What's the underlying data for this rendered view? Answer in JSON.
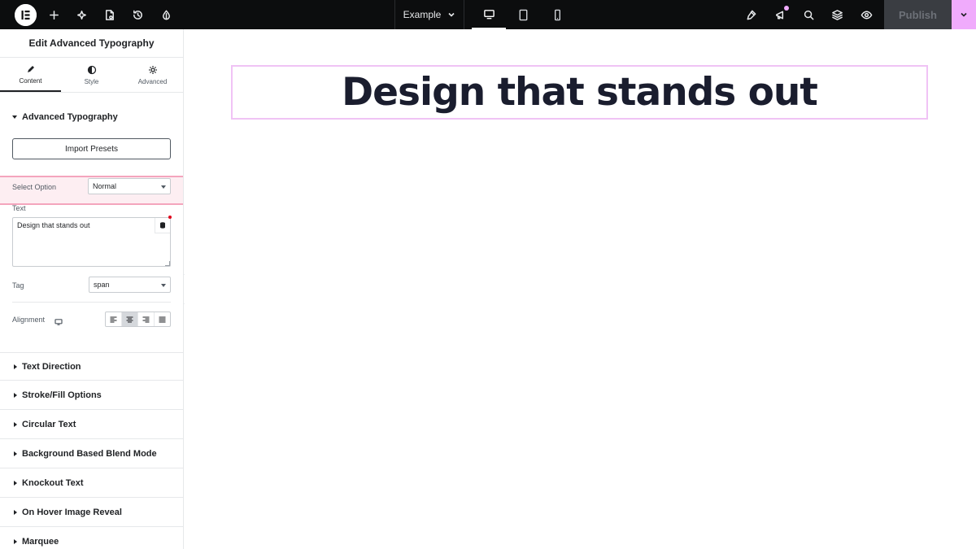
{
  "topbar": {
    "page_name": "Example",
    "publish_label": "Publish",
    "icons": [
      "elementor-logo-icon",
      "add-icon",
      "ai-sparkle-icon",
      "page-settings-icon",
      "history-icon",
      "site-settings-icon",
      "finder-icon",
      "notifications-icon",
      "search-icon",
      "structure-icon",
      "preview-icon"
    ],
    "devices": [
      "desktop",
      "tablet",
      "mobile"
    ],
    "active_device": "desktop",
    "accent_color": "#f0abfc"
  },
  "panel": {
    "title": "Edit Advanced Typography",
    "tabs": [
      {
        "label": "Content",
        "icon": "pencil-icon",
        "active": true
      },
      {
        "label": "Style",
        "icon": "half-circle-icon",
        "active": false
      },
      {
        "label": "Advanced",
        "icon": "gear-icon",
        "active": false
      }
    ],
    "section_title": "Advanced Typography",
    "import_presets_label": "Import Presets",
    "select_option": {
      "label": "Select Option",
      "value": "Normal"
    },
    "text": {
      "label": "Text",
      "value": "Design that stands out"
    },
    "tag": {
      "label": "Tag",
      "value": "span"
    },
    "alignment": {
      "label": "Alignment",
      "options": [
        "left",
        "center",
        "right",
        "justify"
      ],
      "selected": "center"
    },
    "accordions": [
      "Text Direction",
      "Stroke/Fill Options",
      "Circular Text",
      "Background Based Blend Mode",
      "Knockout Text",
      "On Hover Image Reveal",
      "Marquee"
    ]
  },
  "canvas": {
    "heading": "Design that stands out",
    "selection_color": "#f0c3f5"
  }
}
